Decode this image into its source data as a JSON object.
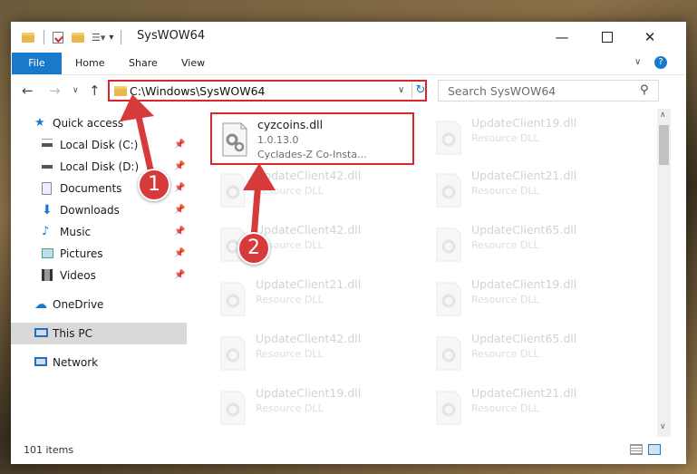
{
  "window": {
    "title": "SysWOW64"
  },
  "ribbon": {
    "tabs": [
      "File",
      "Home",
      "Share",
      "View"
    ]
  },
  "address": {
    "path": "C:\\Windows\\SysWOW64"
  },
  "search": {
    "placeholder": "Search SysWOW64"
  },
  "nav": {
    "quick_access": "Quick access",
    "items": [
      "Local Disk (C:)",
      "Local Disk (D:)",
      "Documents",
      "Downloads",
      "Music",
      "Pictures",
      "Videos"
    ],
    "onedrive": "OneDrive",
    "this_pc": "This PC",
    "network": "Network"
  },
  "files": {
    "highlighted": {
      "name": "cyzcoins.dll",
      "version": "1.0.13.0",
      "desc": "Cyclades-Z Co-Insta..."
    },
    "left_col": [
      {
        "name": "UpdateClient42.dll",
        "type": "Resource DLL"
      },
      {
        "name": "UpdateClient42.dll",
        "type": "Resource DLL"
      },
      {
        "name": "UpdateClient21.dll",
        "type": "Resource DLL"
      },
      {
        "name": "UpdateClient42.dll",
        "type": "Resource DLL"
      },
      {
        "name": "UpdateClient19.dll",
        "type": "Resource DLL"
      }
    ],
    "right_col": [
      {
        "name": "UpdateClient19.dll",
        "type": "Resource DLL"
      },
      {
        "name": "UpdateClient21.dll",
        "type": "Resource DLL"
      },
      {
        "name": "UpdateClient65.dll",
        "type": "Resource DLL"
      },
      {
        "name": "UpdateClient19.dll",
        "type": "Resource DLL"
      },
      {
        "name": "UpdateClient65.dll",
        "type": "Resource DLL"
      },
      {
        "name": "UpdateClient21.dll",
        "type": "Resource DLL"
      }
    ]
  },
  "status": {
    "item_count": "101 items"
  },
  "annotations": {
    "step1": "1",
    "step2": "2"
  },
  "colors": {
    "accent": "#1979ca",
    "highlight": "#d9262b",
    "annotation": "#d63a3a"
  }
}
